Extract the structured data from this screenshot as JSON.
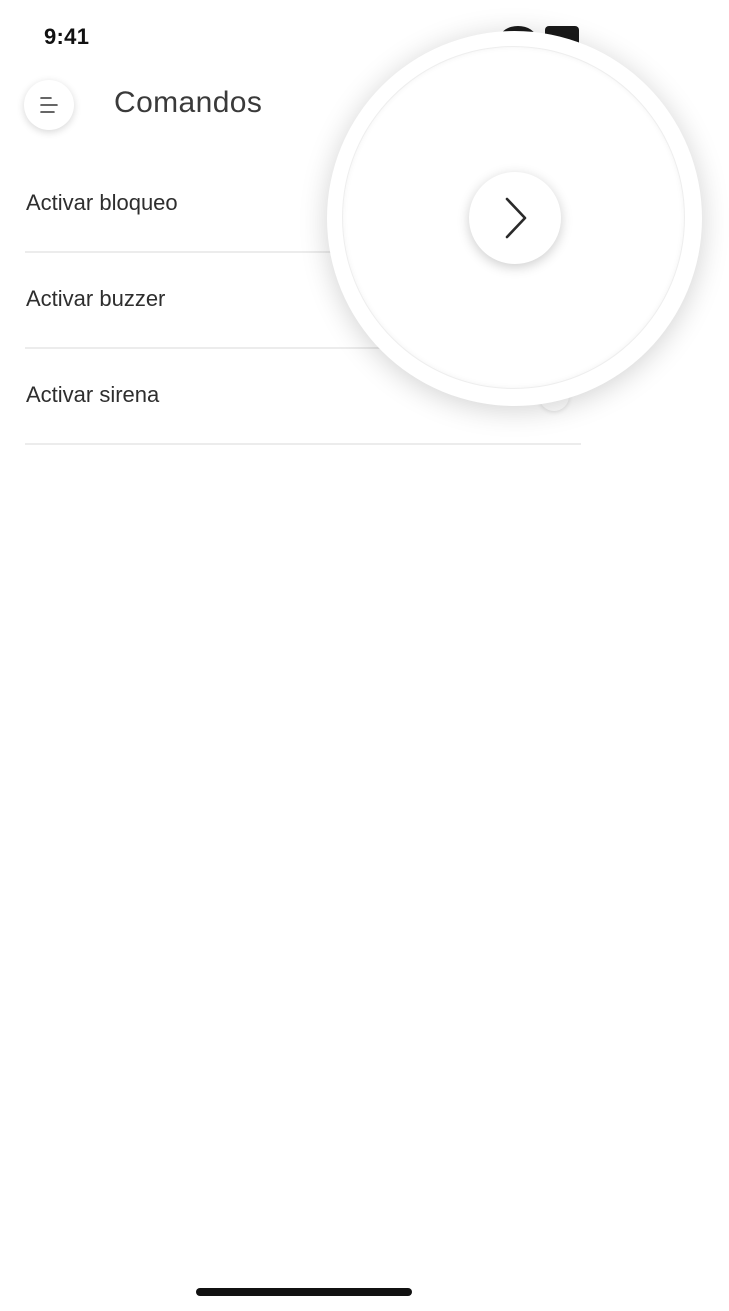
{
  "status_bar": {
    "time": "9:41"
  },
  "header": {
    "title": "Comandos",
    "menu_icon": "menu-icon"
  },
  "commands": [
    {
      "label": "Activar bloqueo",
      "icon": "chevron-right-icon"
    },
    {
      "label": "Activar buzzer",
      "icon": "chevron-right-icon"
    },
    {
      "label": "Activar sirena",
      "icon": "chevron-right-icon"
    }
  ],
  "magnifier": {
    "icon": "chevron-right-icon"
  },
  "colors": {
    "background": "#ffffff",
    "text": "#2e2e2e",
    "divider": "#ececec",
    "indicator": "#111111"
  }
}
